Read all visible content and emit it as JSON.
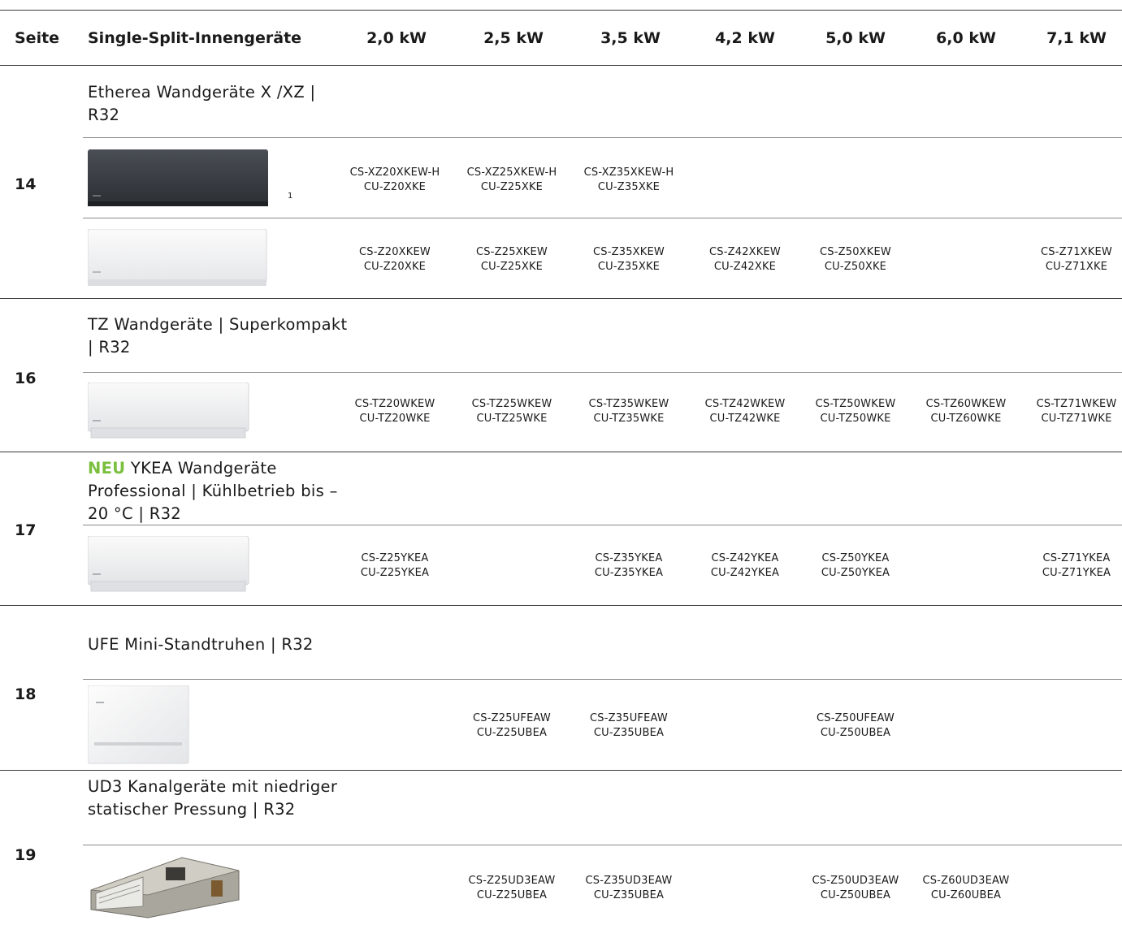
{
  "header": {
    "page_col": "Seite",
    "product_col": "Single-Split-Innengeräte",
    "capacities": [
      "2,0 kW",
      "2,5 kW",
      "3,5 kW",
      "4,2 kW",
      "5,0 kW",
      "6,0 kW",
      "7,1 kW"
    ]
  },
  "sections": [
    {
      "page": "14",
      "title": "Etherea Wandgeräte X /XZ | R32",
      "footnote": "1",
      "rows": [
        [
          {
            "cs": "CS-XZ20XKEW-H",
            "cu": "CU-Z20XKE"
          },
          {
            "cs": "CS-XZ25XKEW-H",
            "cu": "CU-Z25XKE"
          },
          {
            "cs": "CS-XZ35XKEW-H",
            "cu": "CU-Z35XKE"
          }
        ],
        [
          {
            "cs": "CS-Z20XKEW",
            "cu": "CU-Z20XKE"
          },
          {
            "cs": "CS-Z25XKEW",
            "cu": "CU-Z25XKE"
          },
          {
            "cs": "CS-Z35XKEW",
            "cu": "CU-Z35XKE"
          },
          {
            "cs": "CS-Z42XKEW",
            "cu": "CU-Z42XKE"
          },
          {
            "cs": "CS-Z50XKEW",
            "cu": "CU-Z50XKE"
          },
          {
            "cs": "CS-Z71XKEW",
            "cu": "CU-Z71XKE"
          }
        ]
      ]
    },
    {
      "page": "16",
      "title": "TZ Wandgeräte | Superkompakt | R32",
      "rows": [
        [
          {
            "cs": "CS-TZ20WKEW",
            "cu": "CU-TZ20WKE"
          },
          {
            "cs": "CS-TZ25WKEW",
            "cu": "CU-TZ25WKE"
          },
          {
            "cs": "CS-TZ35WKEW",
            "cu": "CU-TZ35WKE"
          },
          {
            "cs": "CS-TZ42WKEW",
            "cu": "CU-TZ42WKE"
          },
          {
            "cs": "CS-TZ50WKEW",
            "cu": "CU-TZ50WKE"
          },
          {
            "cs": "CS-TZ60WKEW",
            "cu": "CU-TZ60WKE"
          },
          {
            "cs": "CS-TZ71WKEW",
            "cu": "CU-TZ71WKE"
          }
        ]
      ]
    },
    {
      "page": "17",
      "badge": "NEU",
      "title": "YKEA Wandgeräte Professional | Kühlbetrieb bis –20 °C | R32",
      "rows": [
        [
          {
            "cs": "CS-Z25YKEA",
            "cu": "CU-Z25YKEA"
          },
          {
            "cs": "CS-Z35YKEA",
            "cu": "CU-Z35YKEA"
          },
          {
            "cs": "CS-Z42YKEA",
            "cu": "CU-Z42YKEA"
          },
          {
            "cs": "CS-Z50YKEA",
            "cu": "CU-Z50YKEA"
          },
          {
            "cs": "CS-Z71YKEA",
            "cu": "CU-Z71YKEA"
          }
        ]
      ]
    },
    {
      "page": "18",
      "title": "UFE Mini-Standtruhen | R32",
      "rows": [
        [
          {
            "cs": "CS-Z25UFEAW",
            "cu": "CU-Z25UBEA"
          },
          {
            "cs": "CS-Z35UFEAW",
            "cu": "CU-Z35UBEA"
          },
          {
            "cs": "CS-Z50UFEAW",
            "cu": "CU-Z50UBEA"
          }
        ]
      ]
    },
    {
      "page": "19",
      "title": "UD3 Kanalgeräte mit niedriger statischer Pressung | R32",
      "rows": [
        [
          {
            "cs": "CS-Z25UD3EAW",
            "cu": "CU-Z25UBEA"
          },
          {
            "cs": "CS-Z35UD3EAW",
            "cu": "CU-Z35UBEA"
          },
          {
            "cs": "CS-Z50UD3EAW",
            "cu": "CU-Z50UBEA"
          },
          {
            "cs": "CS-Z60UD3EAW",
            "cu": "CU-Z60UBEA"
          }
        ]
      ]
    }
  ],
  "colors": {
    "accent_neu": "#7bbf3e",
    "rule": "#3a3a3a"
  }
}
